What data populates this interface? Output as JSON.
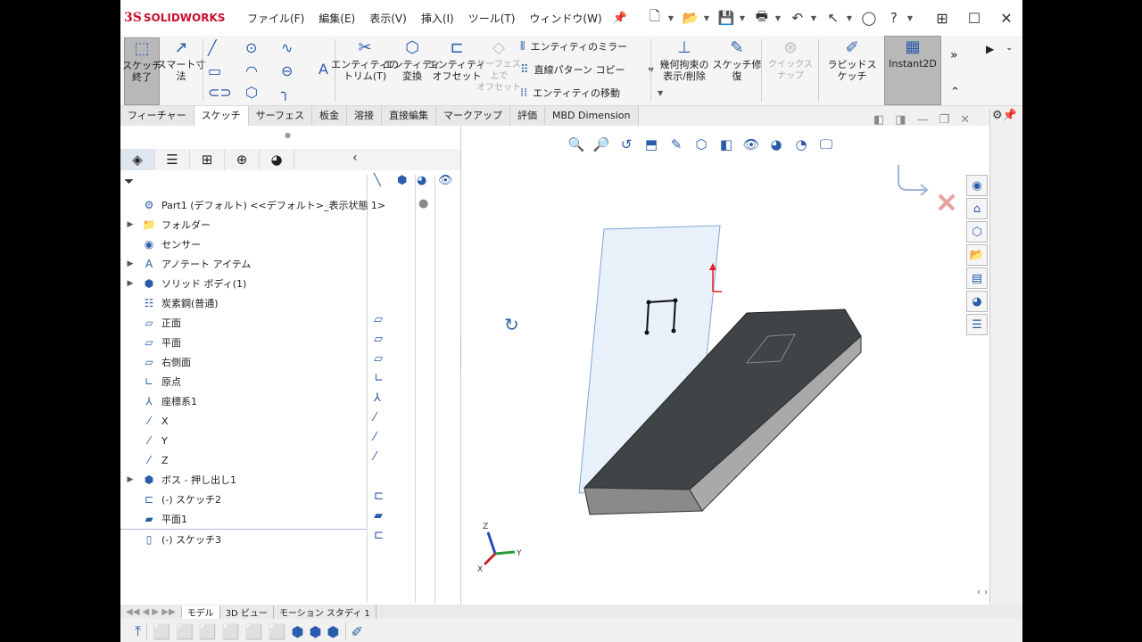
{
  "app": {
    "logo_prefix": "3S",
    "logo_name": "SOLIDWORKS"
  },
  "menu": [
    "ファイル(F)",
    "編集(E)",
    "表示(V)",
    "挿入(I)",
    "ツール(T)",
    "ウィンドウ(W)"
  ],
  "commands": {
    "sketch_end": "スケッチ\n終了",
    "smart_dim": "スマート寸\n法",
    "trim": "エンティティの\nトリム(T)",
    "convert": "エンティティ\n変換",
    "offset": "エンティティ\nオフセット",
    "surface_offset": "サーフェス\n上で\nオフセット",
    "mirror": "エンティティのミラー",
    "linear_pattern": "直線パターン コピー",
    "move": "エンティティの移動",
    "relations": "幾何拘束の\n表示/削除",
    "repair": "スケッチ修\n復",
    "quick_snap": "クイックスナップ",
    "rapid_sketch": "ラピッドスケッチ",
    "instant2d": "Instant2D"
  },
  "tabs": [
    "フィーチャー",
    "スケッチ",
    "サーフェス",
    "板金",
    "溶接",
    "直接編集",
    "マークアップ",
    "評価",
    "MBD Dimension"
  ],
  "tree": [
    {
      "label": "Part1 (デフォルト) <<デフォルト>_表示状態 1>",
      "icon": "part-icon",
      "arrow": ""
    },
    {
      "label": "フォルダー",
      "icon": "folder-icon",
      "arrow": "▶"
    },
    {
      "label": "センサー",
      "icon": "sensor-icon",
      "arrow": ""
    },
    {
      "label": "アノテート アイテム",
      "icon": "annotation-icon",
      "arrow": "▶"
    },
    {
      "label": "ソリッド ボディ(1)",
      "icon": "solid-body-icon",
      "arrow": "▶"
    },
    {
      "label": "炭素鋼(普通)",
      "icon": "material-icon",
      "arrow": ""
    },
    {
      "label": "正面",
      "icon": "plane-icon",
      "arrow": ""
    },
    {
      "label": "平面",
      "icon": "plane-icon",
      "arrow": ""
    },
    {
      "label": "右側面",
      "icon": "plane-icon",
      "arrow": ""
    },
    {
      "label": "原点",
      "icon": "origin-icon",
      "arrow": ""
    },
    {
      "label": "座標系1",
      "icon": "coordinate-system-icon",
      "arrow": ""
    },
    {
      "label": "X",
      "icon": "axis-icon",
      "arrow": ""
    },
    {
      "label": "Y",
      "icon": "axis-icon",
      "arrow": ""
    },
    {
      "label": "Z",
      "icon": "axis-icon",
      "arrow": ""
    },
    {
      "label": "ボス - 押し出し1",
      "icon": "extrude-icon",
      "arrow": "▶"
    },
    {
      "label": "(-) スケッチ2",
      "icon": "sketch-icon",
      "arrow": ""
    },
    {
      "label": "平面1",
      "icon": "plane-icon",
      "arrow": ""
    },
    {
      "label": "(-) スケッチ3",
      "icon": "sketch-icon",
      "arrow": ""
    }
  ],
  "bottom_tabs": [
    "モデル",
    "3D ビュー",
    "モーション スタディ 1"
  ],
  "triad": {
    "x": "X",
    "y": "Y",
    "z": "Z"
  }
}
